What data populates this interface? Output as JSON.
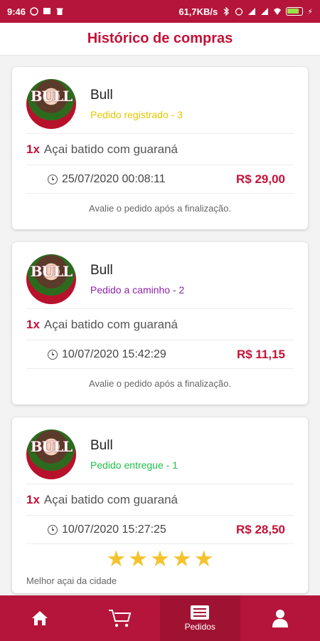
{
  "status_bar": {
    "time": "9:46",
    "network_speed": "61,7KB/s",
    "battery_level": "70%"
  },
  "header": {
    "title": "Histórico de compras"
  },
  "orders": [
    {
      "store": "Bull",
      "status": "Pedido registrado - 3",
      "status_color": "#e6c600",
      "qty": "1x",
      "item": "Açai batido com guaraná",
      "datetime": "25/07/2020 00:08:11",
      "price": "R$ 29,00",
      "note": "Avalie o pedido após a finalização."
    },
    {
      "store": "Bull",
      "status": "Pedido a caminho - 2",
      "status_color": "#8e24aa",
      "qty": "1x",
      "item": "Açai batido com guaraná",
      "datetime": "10/07/2020 15:42:29",
      "price": "R$ 11,15",
      "note": "Avalie o pedido após a finalização."
    },
    {
      "store": "Bull",
      "status": "Pedido entregue - 1",
      "status_color": "#20c04a",
      "qty": "1x",
      "item": "Açai batido com guaraná",
      "datetime": "10/07/2020 15:27:25",
      "price": "R$ 28,50",
      "rating": 5,
      "review": "Melhor açai da cidade"
    }
  ],
  "logo_text": "BULL",
  "bottom_nav": {
    "items": [
      {
        "icon": "home-icon",
        "label": ""
      },
      {
        "icon": "cart-icon",
        "label": ""
      },
      {
        "icon": "orders-icon",
        "label": "Pedidos"
      },
      {
        "icon": "user-icon",
        "label": ""
      }
    ],
    "active": "Pedidos"
  },
  "colors": {
    "brand": "#b5153a",
    "accent": "#c41237"
  }
}
